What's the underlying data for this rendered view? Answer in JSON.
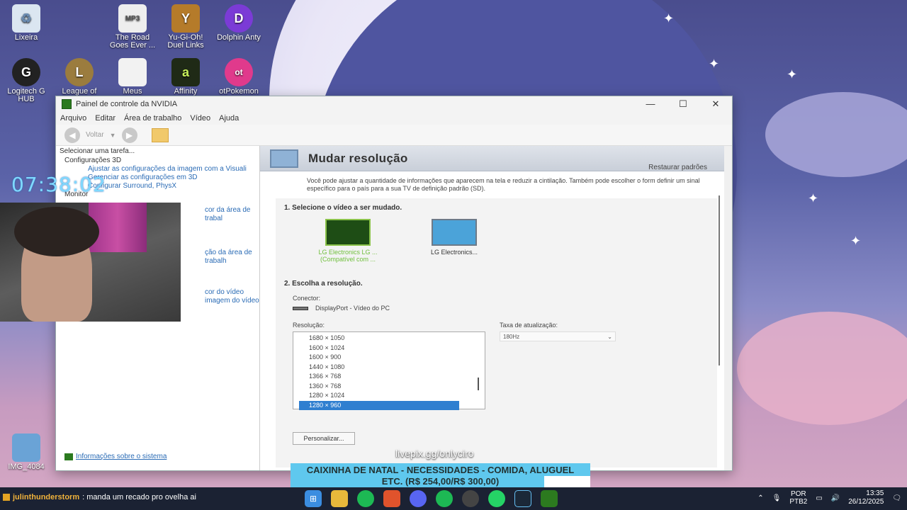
{
  "desktop": {
    "icons": [
      {
        "label": "Lixeira"
      },
      {
        "label": "The Road Goes Ever ..."
      },
      {
        "label": "Yu-Gi-Oh! Duel Links"
      },
      {
        "label": "Dolphin Anty"
      },
      {
        "label": "Logitech G HUB"
      },
      {
        "label": "League of"
      },
      {
        "label": "Meus"
      },
      {
        "label": "Affinity"
      },
      {
        "label": "otPokemon"
      },
      {
        "label": "IMG_4084"
      }
    ]
  },
  "window": {
    "title": "Painel de controle da NVIDIA",
    "menu": [
      "Arquivo",
      "Editar",
      "Área de trabalho",
      "Vídeo",
      "Ajuda"
    ],
    "toolbar": {
      "back_label": "Voltar"
    },
    "left": {
      "header": "Selecionar uma tarefa...",
      "tree": {
        "group1": "Configurações 3D",
        "item1": "Ajustar as configurações da imagem com a Visuali",
        "item2": "Gerenciar as configurações em 3D",
        "item3": "Configurar Surround, PhysX",
        "group2": "Monitor",
        "item4": "cor da área de trabal",
        "item5": "ção da área de trabalh",
        "item6": "cor do vídeo",
        "item7": "imagem do vídeo"
      },
      "sysinfo": "Informações sobre o sistema"
    },
    "right": {
      "title": "Mudar resolução",
      "restore": "Restaurar padrões",
      "description": "Você pode ajustar a quantidade de informações que aparecem na tela e reduzir a cintilação. Também pode escolher o form definir um sinal específico para o país para a sua TV de definição padrão (SD).",
      "step1": "1. Selecione o vídeo a ser mudado.",
      "displays": [
        {
          "label1": "LG Electronics LG ...",
          "label2": "(Compatível com ..."
        },
        {
          "label1": "LG Electronics...",
          "label2": ""
        }
      ],
      "step2": "2. Escolha a resolução.",
      "connector_label": "Conector:",
      "connector_value": "DisplayPort - Vídeo do PC",
      "resolution_label": "Resolução:",
      "resolutions": [
        "1680 × 1050",
        "1600 × 1024",
        "1600 × 900",
        "1440 × 1080",
        "1366 × 768",
        "1360 × 768",
        "1280 × 1024",
        "1280 × 960"
      ],
      "selected_resolution": "1280 × 960",
      "refresh_label": "Taxa de atualização:",
      "refresh_value": "180Hz",
      "customize_button": "Personalizar..."
    }
  },
  "overlay": {
    "timer": "07:38:02",
    "donation_url": "livepix.gg/onlyciro",
    "donation_line1": "CAIXINHA DE NATAL - NECESSIDADES - COMIDA, ALUGUEL",
    "donation_line2": "ETC. (R$ 254,00/R$ 300,00)",
    "donation_progress": 0.847
  },
  "chat": {
    "username": "julinthunderstorm",
    "message": ": manda um recado pro ovelha ai"
  },
  "taskbar": {
    "lang_top": "POR",
    "lang_bottom": "PTB2",
    "time": "13:35",
    "date": "26/12/2025"
  }
}
